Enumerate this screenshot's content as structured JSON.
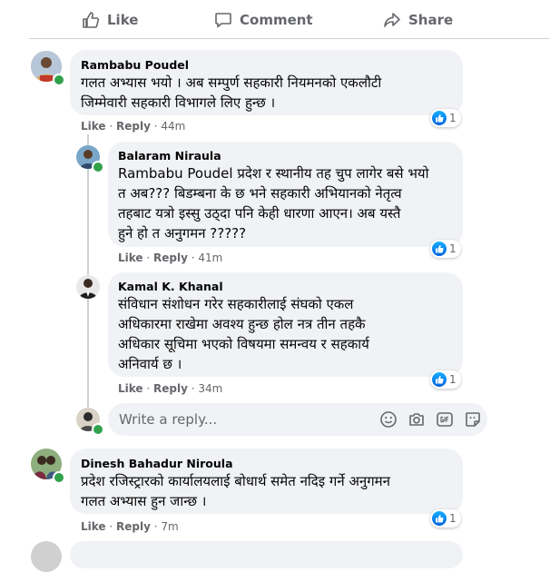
{
  "actions": {
    "like": "Like",
    "comment": "Comment",
    "share": "Share"
  },
  "comments": [
    {
      "author": "Rambabu Poudel",
      "lines": [
        "गलत अभ्यास भयो । अब सम्पुर्ण सहकारी नियमनको एकलौटी",
        "जिम्मेवारी सहकारी विभागले लिए हुन्छ ।"
      ],
      "like": "Like",
      "reply": "Reply",
      "time": "44m",
      "reactions": "1"
    },
    {
      "author": "Balaram Niraula",
      "mention": "Rambabu Poudel",
      "lines": [
        "प्रदेश र स्थानीय तह चुप लागेर बसे भयो",
        "त अब??? बिडम्बना के छ भने सहकारी अभियानको नेतृत्व",
        "तहबाट यत्रो इस्सु उठ्दा पनि केही धारणा आएन। अब यस्तै",
        "हुने हो त अनुगमन ?????"
      ],
      "like": "Like",
      "reply": "Reply",
      "time": "41m",
      "reactions": "1"
    },
    {
      "author": "Kamal K. Khanal",
      "lines": [
        "संविधान संशोधन गरेर सहकारीलाई संघको एकल",
        "अधिकारमा राखेमा अवश्य हुन्छ होल नत्र तीन तहकै",
        "अधिकार सूचिमा भएको विषयमा समन्वय र सहकार्य",
        "अनिवार्य छ ।"
      ],
      "like": "Like",
      "reply": "Reply",
      "time": "34m",
      "reactions": "1"
    },
    {
      "author": "Dinesh Bahadur Niroula",
      "lines": [
        "प्रदेश रजिस्ट्रारको कार्यालयलाई बोधार्थ समेत नदिइ गर्ने अनुगमन",
        "गलत अभ्यास हुन जान्छ ।"
      ],
      "like": "Like",
      "reply": "Reply",
      "time": "7m",
      "reactions": "1"
    }
  ],
  "reply_input": {
    "placeholder": "Write a reply..."
  },
  "icons": {
    "like": "thumbs-up-icon",
    "comment": "speech-bubble-icon",
    "share": "share-arrow-icon",
    "emoji": "emoji-icon",
    "camera": "camera-icon",
    "gif": "gif-icon",
    "sticker": "sticker-icon",
    "reaction": "like-reaction-icon"
  },
  "colors": {
    "bubble": "#f0f2f5",
    "meta_text": "#65676b",
    "online": "#31a24c",
    "like_blue": "#1877f2"
  }
}
